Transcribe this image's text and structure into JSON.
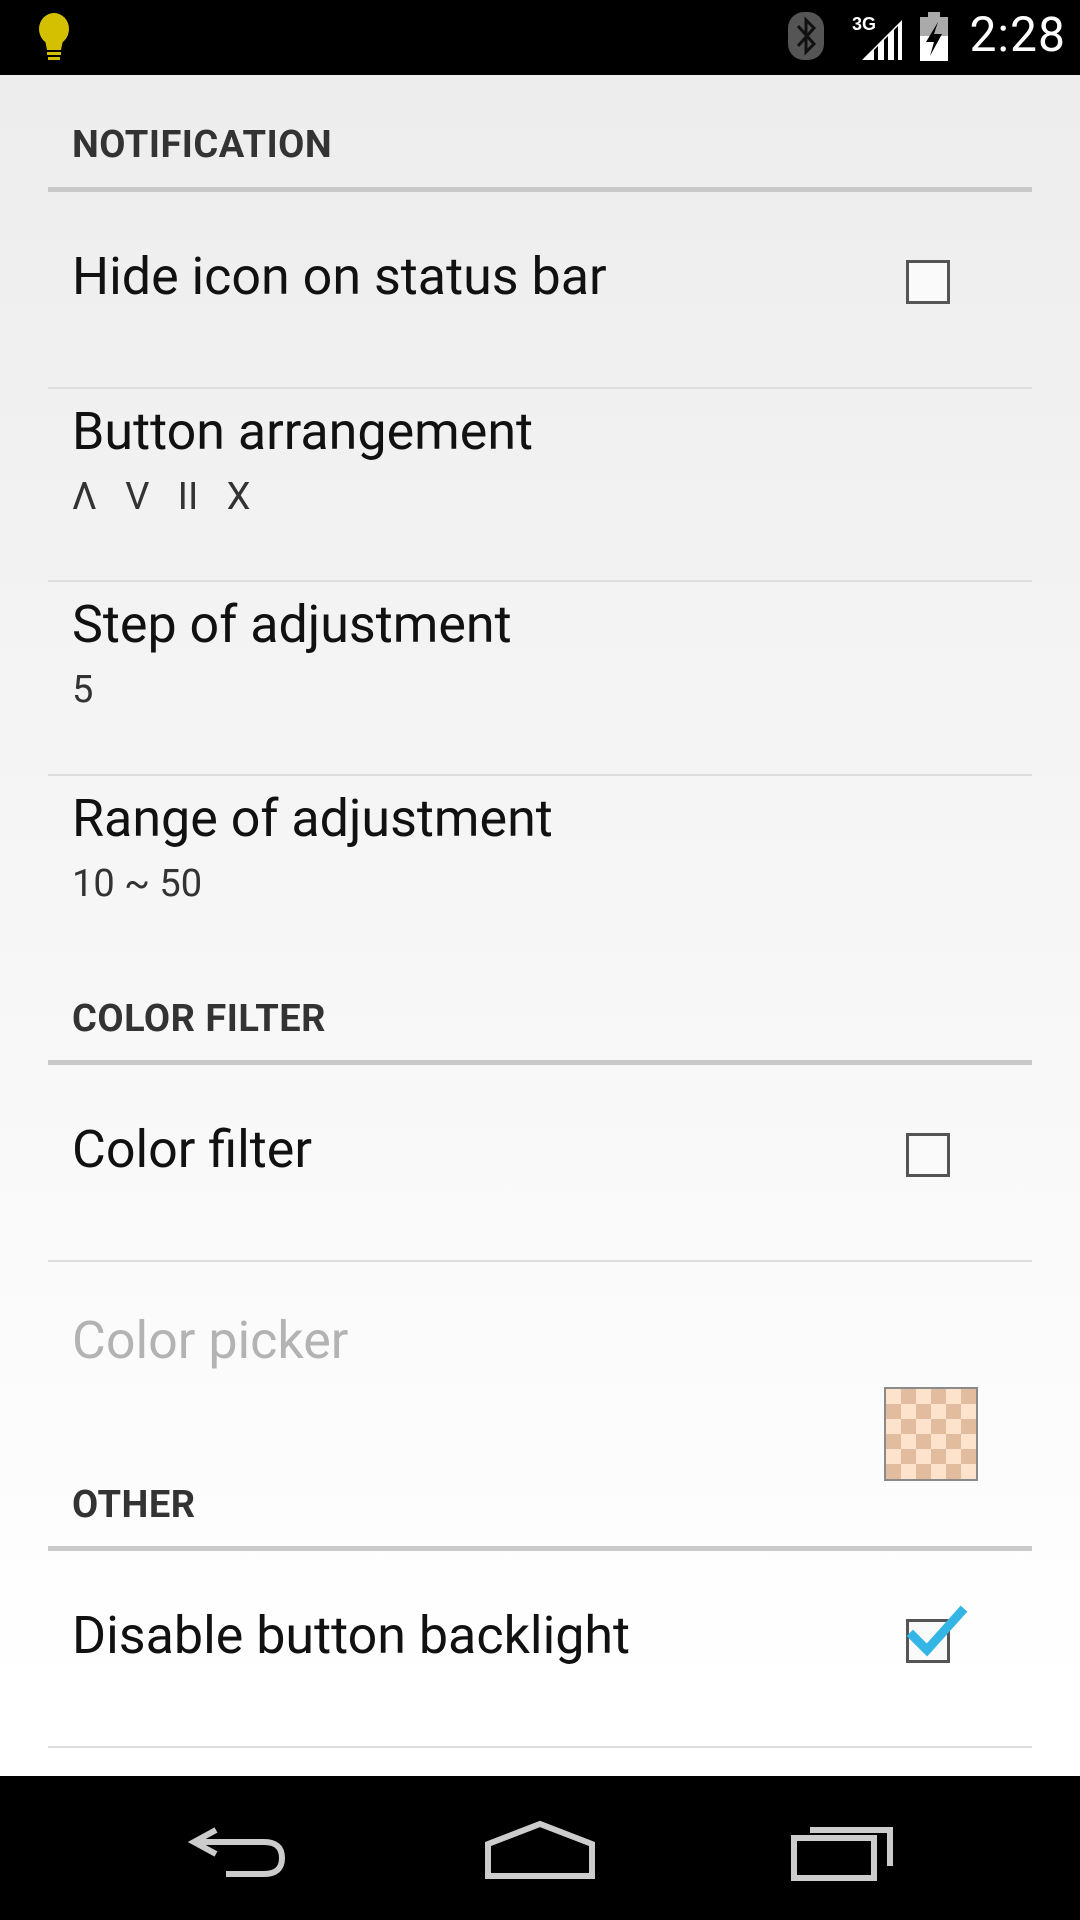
{
  "status_bar": {
    "time": "2:28",
    "network": "3G",
    "icons": [
      "lightbulb-icon",
      "bluetooth-icon",
      "signal-icon",
      "battery-charging-icon"
    ]
  },
  "sections": {
    "notification": {
      "header": "NOTIFICATION",
      "hide_icon": {
        "title": "Hide icon on status bar",
        "checked": false
      },
      "button_arrangement": {
        "title": "Button arrangement",
        "summary": "Λ   V   II   X"
      },
      "step": {
        "title": "Step of adjustment",
        "summary": "5"
      },
      "range": {
        "title": "Range of adjustment",
        "summary": "10 ~ 50"
      }
    },
    "color_filter": {
      "header": "COLOR FILTER",
      "filter": {
        "title": "Color filter",
        "checked": false
      },
      "picker": {
        "title": "Color picker",
        "enabled": false,
        "swatch_color": "#fde3cc"
      }
    },
    "other": {
      "header": "OTHER",
      "backlight": {
        "title": "Disable button backlight",
        "checked": true
      }
    }
  },
  "nav_bar": {
    "buttons": [
      "back-icon",
      "home-icon",
      "recents-icon"
    ]
  },
  "colors": {
    "accent": "#33b5e5",
    "status_bar_bg": "#000000",
    "bulb": "#d4c000"
  }
}
